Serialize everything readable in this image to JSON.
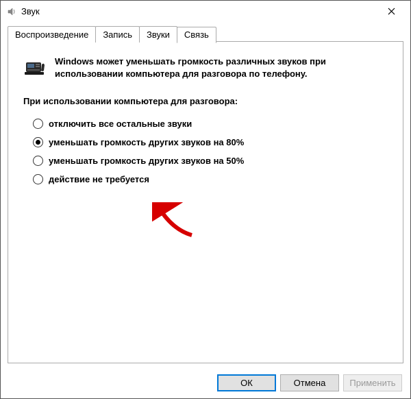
{
  "window": {
    "title": "Звук"
  },
  "tabs": {
    "playback": "Воспроизведение",
    "recording": "Запись",
    "sounds": "Звуки",
    "communication": "Связь"
  },
  "panel": {
    "description": "Windows может уменьшать громкость различных звуков при использовании компьютера для разговора по телефону.",
    "section_label": "При использовании компьютера для разговора:",
    "radios": {
      "mute": "отключить все остальные звуки",
      "reduce80": "уменьшать громкость других звуков на 80%",
      "reduce50": "уменьшать громкость других звуков на 50%",
      "none": "действие не требуется"
    }
  },
  "buttons": {
    "ok": "ОК",
    "cancel": "Отмена",
    "apply": "Применить"
  }
}
